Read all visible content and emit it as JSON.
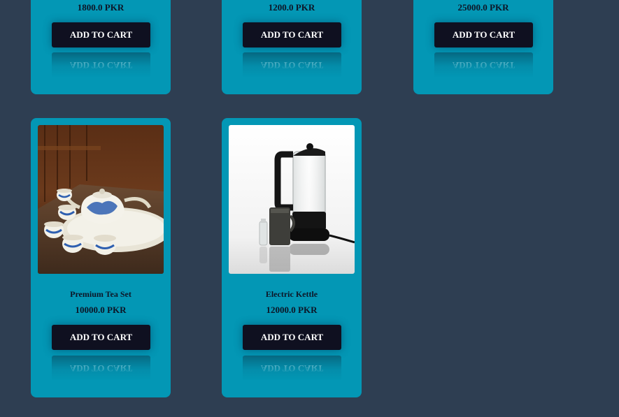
{
  "products_top": [
    {
      "price": "1800.0 PKR",
      "button_label": "ADD TO CART"
    },
    {
      "price": "1200.0 PKR",
      "button_label": "ADD TO CART"
    },
    {
      "price": "25000.0 PKR",
      "button_label": "ADD TO CART"
    }
  ],
  "products_bottom": [
    {
      "name": "Premium Tea Set",
      "price": "10000.0 PKR",
      "button_label": "ADD TO CART"
    },
    {
      "name": "Electric Kettle",
      "price": "12000.0 PKR",
      "button_label": "ADD TO CART"
    }
  ],
  "colors": {
    "background": "#2e3e52",
    "card": "#0397b5",
    "button": "#0f1020",
    "text": "#0d1526"
  }
}
